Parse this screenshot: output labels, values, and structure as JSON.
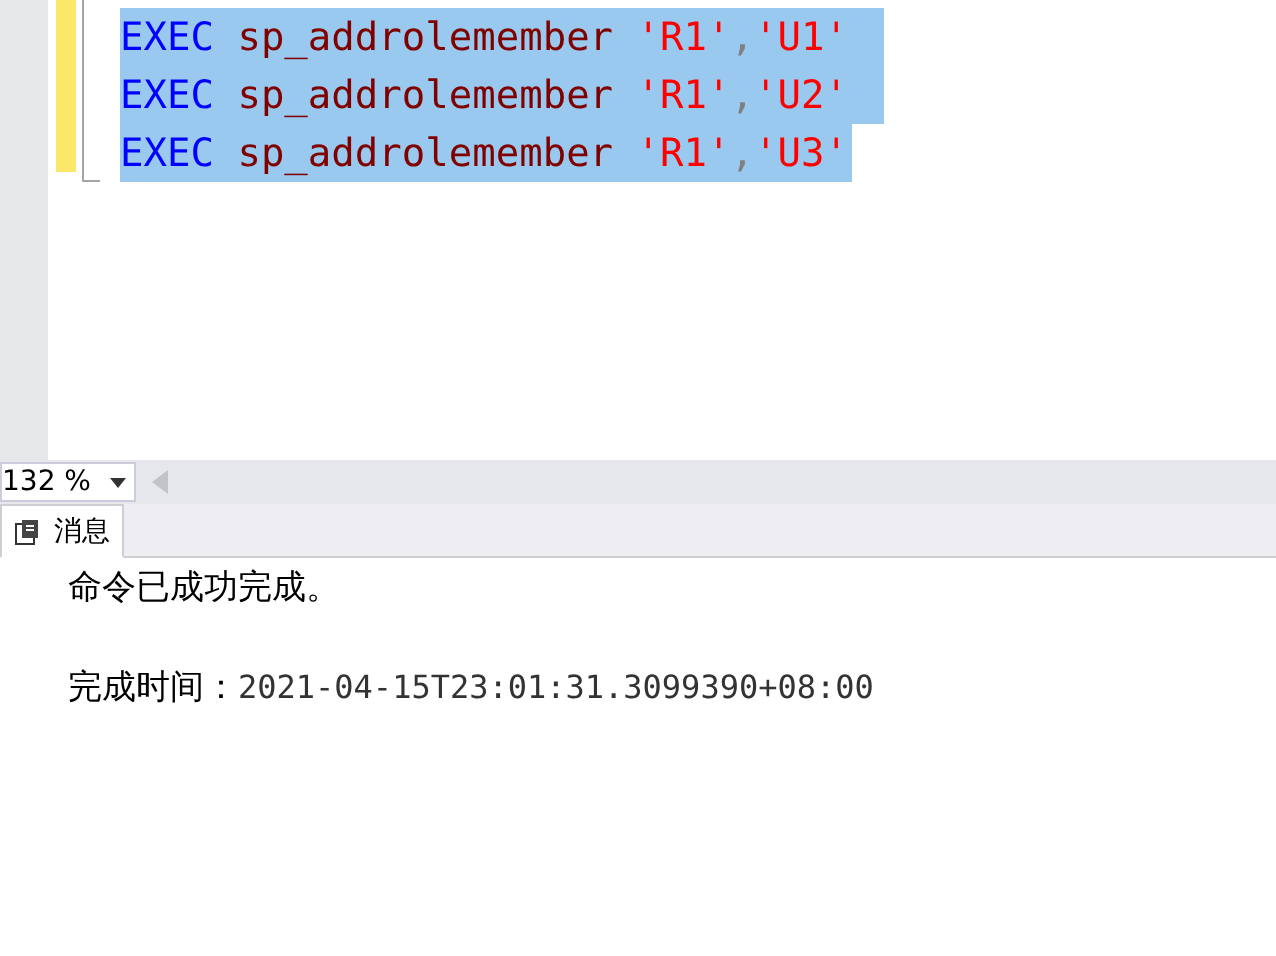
{
  "editor": {
    "lines": [
      {
        "selected": true,
        "tokens": [
          {
            "kind": "keyword",
            "text": "EXEC"
          },
          {
            "kind": "ident",
            "text": "sp_addrolemember"
          },
          {
            "kind": "string",
            "text": "'R1'"
          },
          {
            "kind": "punct",
            "text": ","
          },
          {
            "kind": "string",
            "text": "'U1'"
          }
        ]
      },
      {
        "selected": true,
        "tokens": [
          {
            "kind": "keyword",
            "text": "EXEC"
          },
          {
            "kind": "ident",
            "text": "sp_addrolemember"
          },
          {
            "kind": "string",
            "text": "'R1'"
          },
          {
            "kind": "punct",
            "text": ","
          },
          {
            "kind": "string",
            "text": "'U2'"
          }
        ]
      },
      {
        "selected": true,
        "tokens": [
          {
            "kind": "keyword",
            "text": "EXEC"
          },
          {
            "kind": "ident",
            "text": "sp_addrolemember"
          },
          {
            "kind": "string",
            "text": "'R1'"
          },
          {
            "kind": "punct",
            "text": ","
          },
          {
            "kind": "string",
            "text": "'U3'"
          }
        ]
      }
    ]
  },
  "zoom": "132 %",
  "tabs": [
    {
      "label": "消息",
      "selected": true
    }
  ],
  "messages": [
    {
      "label": "命令已成功完成。"
    },
    {
      "label": "完成时间：",
      "value": "2021-04-15T23:01:31.3099390+08:00"
    }
  ]
}
